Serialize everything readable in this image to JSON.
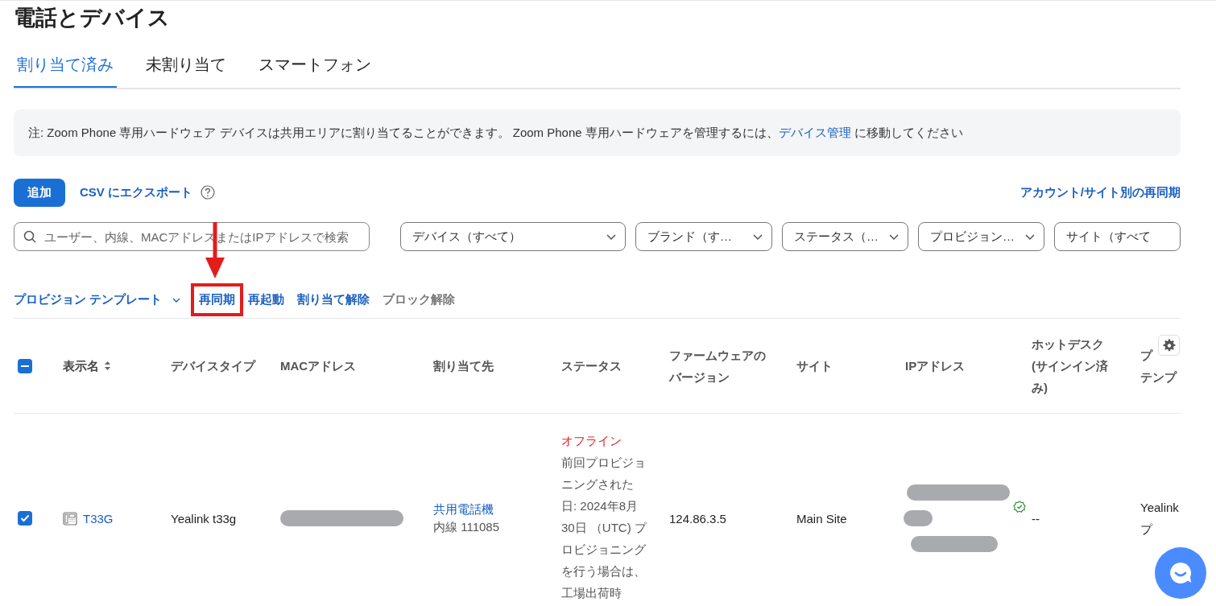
{
  "title": "電話とデバイス",
  "tabs": [
    {
      "label": "割り当て済み",
      "selected": true
    },
    {
      "label": "未割り当て",
      "selected": false
    },
    {
      "label": "スマートフォン",
      "selected": false
    }
  ],
  "notice": {
    "before": "注: Zoom Phone 専用ハードウェア デバイスは共用エリアに割り当てることができます。 Zoom Phone 専用ハードウェアを管理するには、",
    "link": "デバイス管理",
    "after": " に移動してください"
  },
  "toolbar": {
    "add_button": "追加",
    "export_link": "CSV にエクスポート",
    "resync_link": "アカウント/サイト別の再同期"
  },
  "search": {
    "placeholder": "ユーザー、内線、MACアドレスまたはIPアドレスで検索"
  },
  "filters": [
    {
      "label": "デバイス（すべて）",
      "chevron": true
    },
    {
      "label": "ブランド（す…",
      "chevron": true
    },
    {
      "label": "ステータス（…",
      "chevron": true
    },
    {
      "label": "プロビジョン…",
      "chevron": true
    },
    {
      "label": "サイト（すべて",
      "chevron": false
    }
  ],
  "actions": [
    {
      "label": "プロビジョン テンプレート",
      "kind": "menu",
      "disabled": false,
      "highlighted": false
    },
    {
      "label": "再同期",
      "kind": "link",
      "disabled": false,
      "highlighted": true
    },
    {
      "label": "再起動",
      "kind": "link",
      "disabled": false,
      "highlighted": false
    },
    {
      "label": "割り当て解除",
      "kind": "link",
      "disabled": false,
      "highlighted": false
    },
    {
      "label": "ブロック解除",
      "kind": "link",
      "disabled": true,
      "highlighted": false
    }
  ],
  "table": {
    "select_all": {
      "indeterminate": true
    },
    "columns": [
      {
        "label": "表示名",
        "sortable": true
      },
      {
        "label": "デバイスタイプ",
        "sortable": false
      },
      {
        "label": "MACアドレス",
        "sortable": false
      },
      {
        "label": "割り当て先",
        "sortable": false
      },
      {
        "label": "ステータス",
        "sortable": false
      },
      {
        "label": "ファームウェアのバージョン",
        "sortable": false
      },
      {
        "label": "サイト",
        "sortable": false
      },
      {
        "label": "IPアドレス",
        "sortable": false
      },
      {
        "label": "ホットデスク (サインイン済み)",
        "sortable": false
      },
      {
        "lines": [
          "プ",
          "テンプ"
        ],
        "sortable": false
      }
    ],
    "rows": [
      {
        "selected": true,
        "name": "T33G",
        "device_type": "Yealink t33g",
        "assignee": "共用電話機",
        "extension": "内線 111085",
        "status": {
          "kind": "offline",
          "label": "オフライン",
          "detail": "前回プロビジョニングされた日: 2024年8月30日 （UTC) プロビジョニングを行う場合は、工場出荷時"
        },
        "firmware": "124.86.3.5",
        "site": "Main Site",
        "ip_verified": true,
        "hotdesk": "--",
        "column_10": [
          "Yealink",
          "プ"
        ]
      }
    ]
  }
}
